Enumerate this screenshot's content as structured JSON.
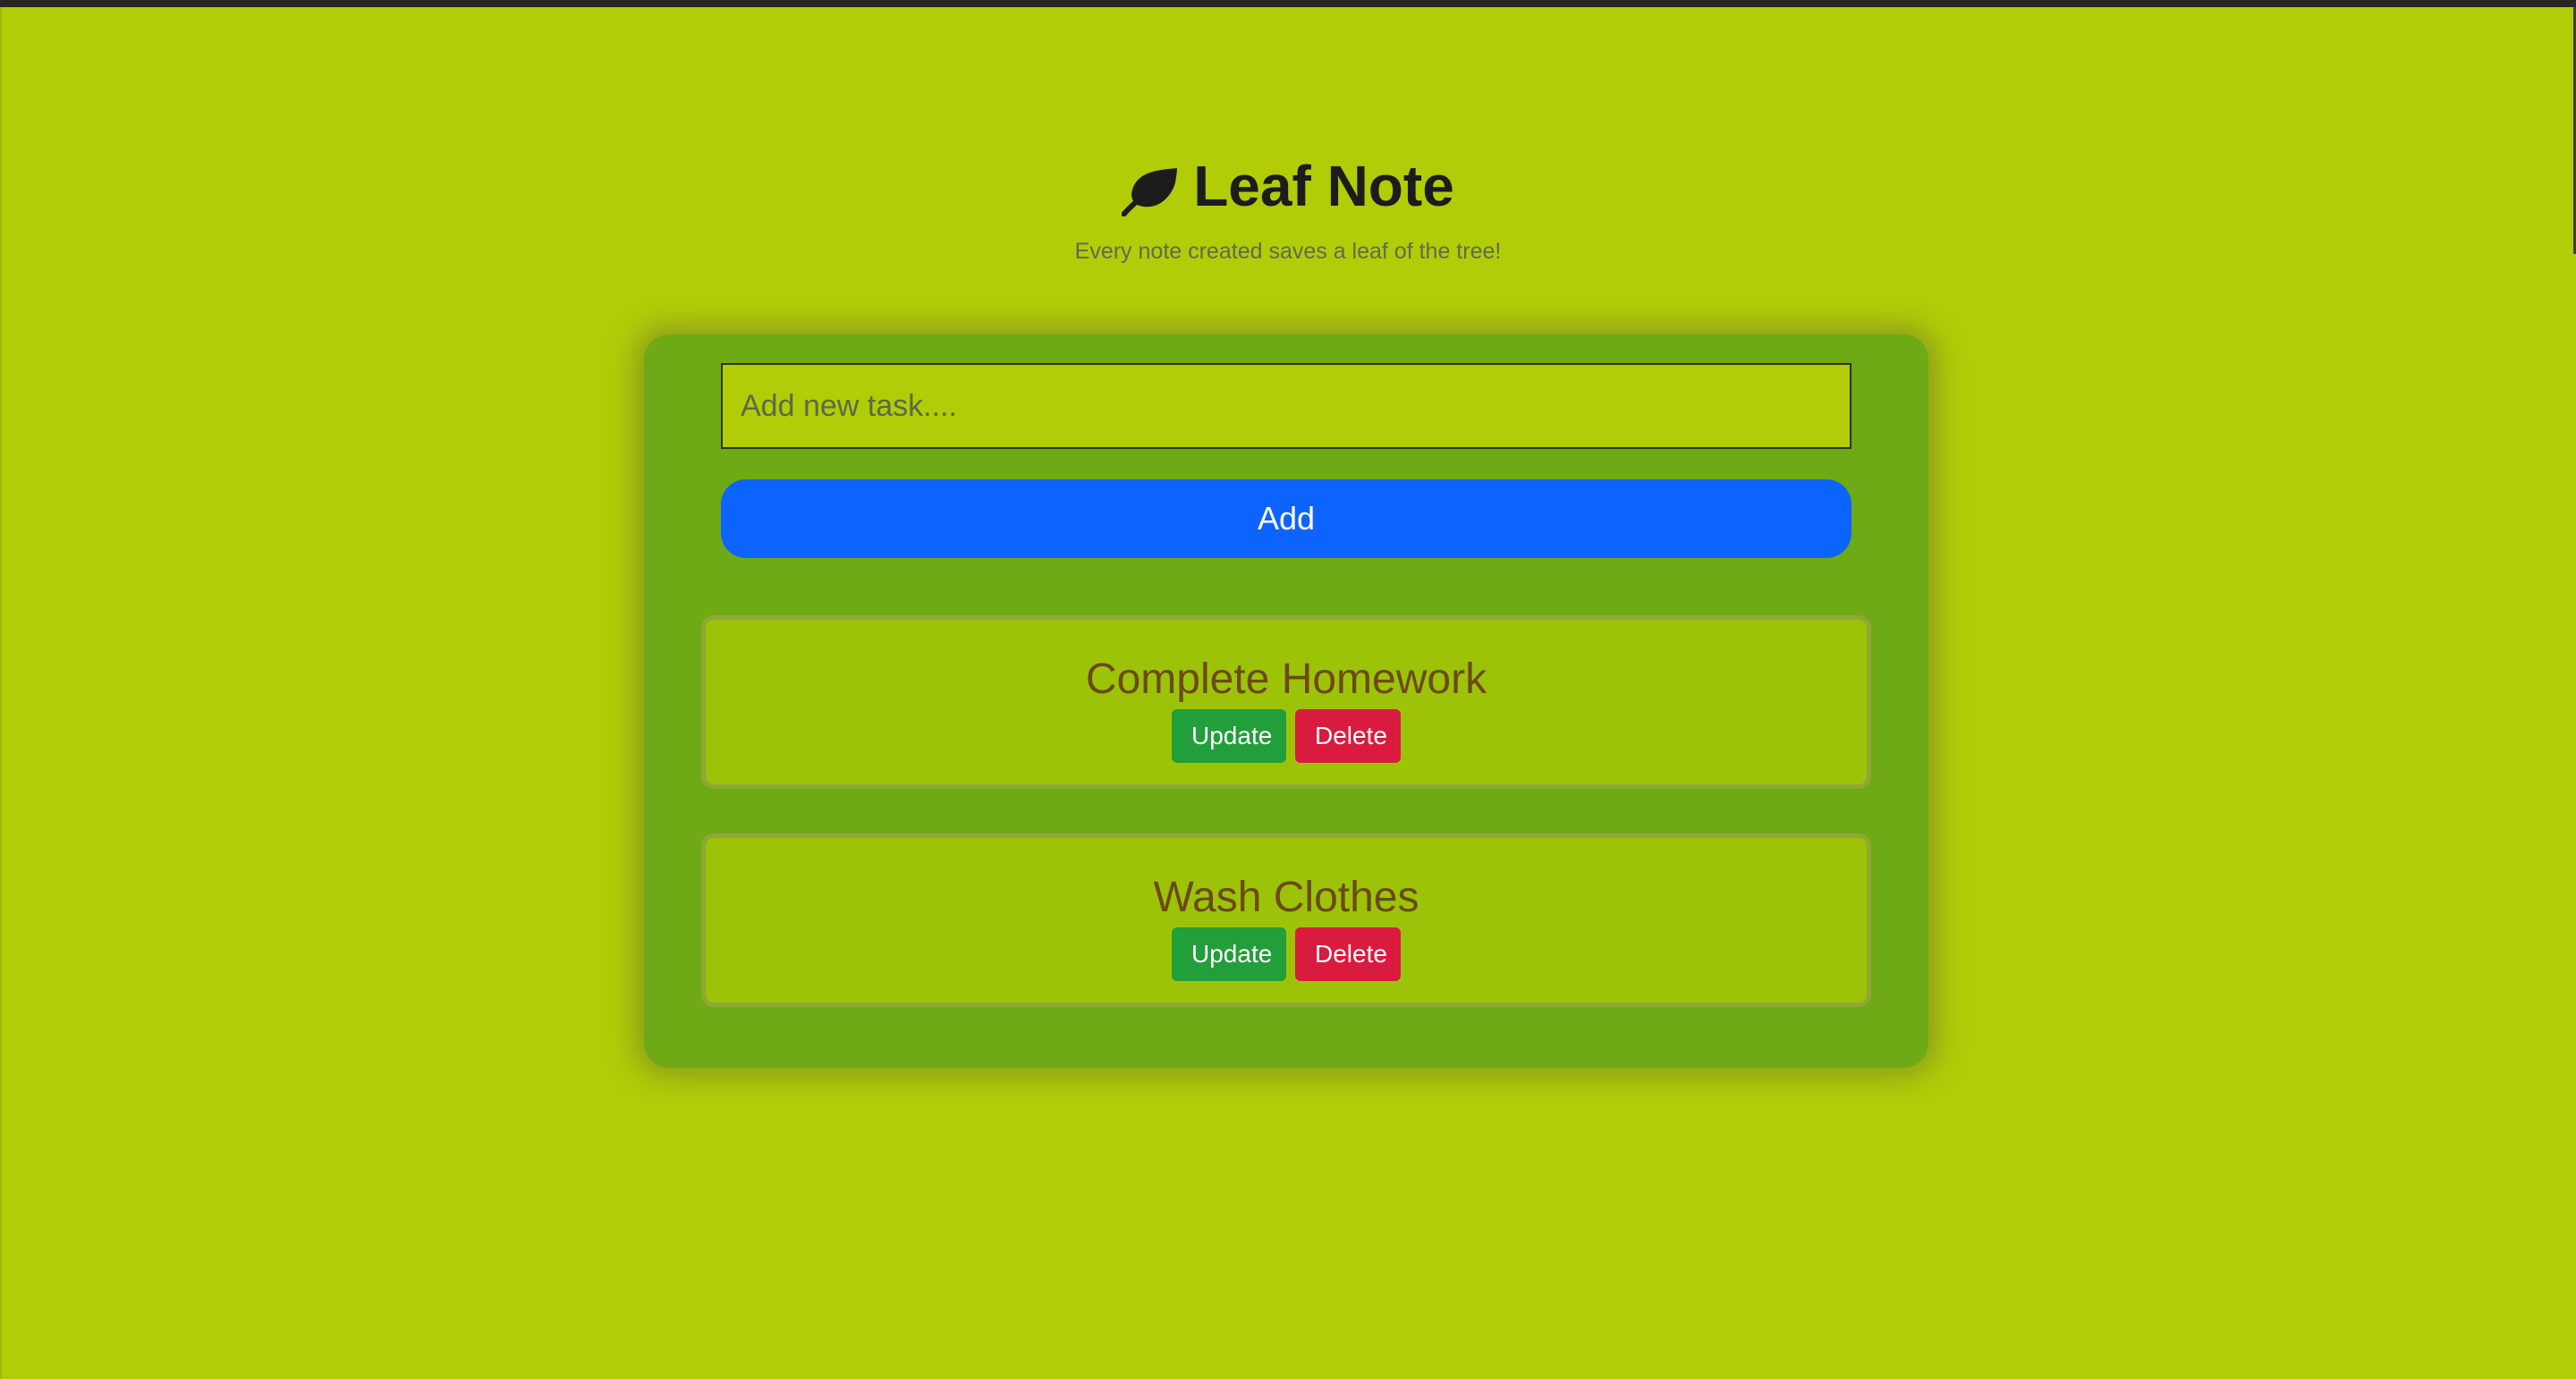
{
  "app": {
    "title": "Leaf Note",
    "subtitle": "Every note created saves a leaf of the tree!",
    "icon": "leaf-icon"
  },
  "form": {
    "input_value": "",
    "input_placeholder": "Add new task....",
    "add_label": "Add"
  },
  "tasks": [
    {
      "title": "Complete Homework",
      "update_label": "Update",
      "delete_label": "Delete"
    },
    {
      "title": "Wash Clothes",
      "update_label": "Update",
      "delete_label": "Delete"
    }
  ],
  "colors": {
    "background": "#b2cc08",
    "panel": "#6ea916",
    "card": "#9dc309",
    "primary": "#0d63fd",
    "success": "#229e3a",
    "danger": "#d91b3f",
    "task_text": "#6b4a14"
  }
}
